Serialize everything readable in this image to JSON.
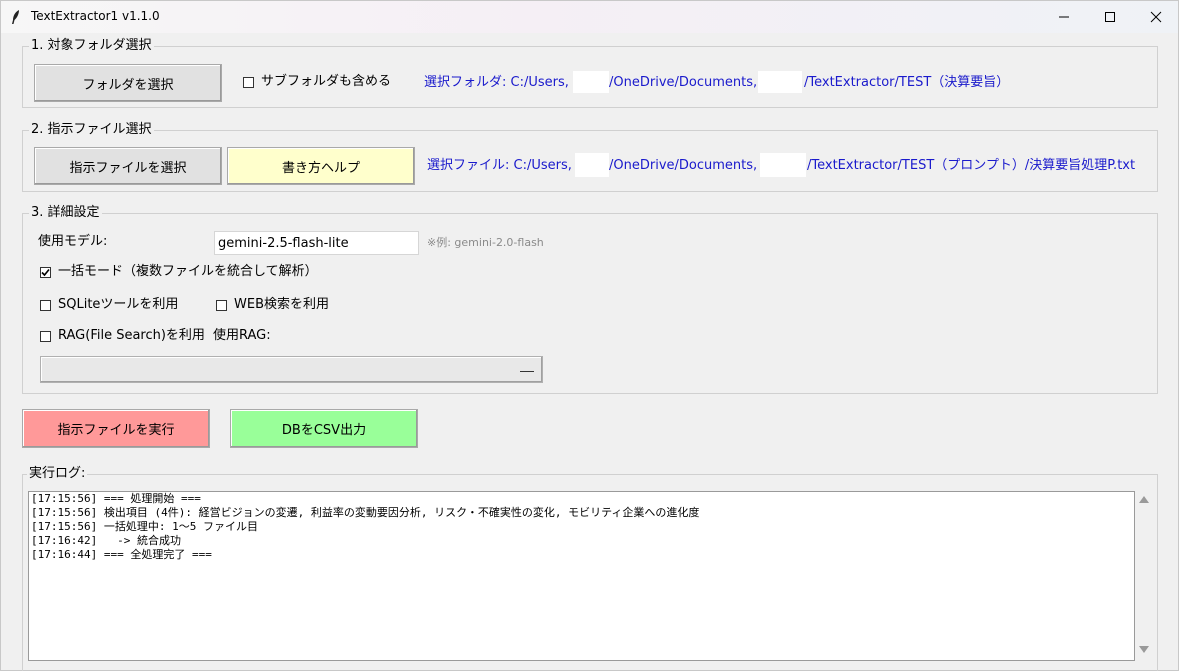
{
  "window": {
    "title": "TextExtractor1 v1.1.0"
  },
  "folder_section": {
    "group_label": "1. 対象フォルダ選択",
    "select_button": "フォルダを選択",
    "include_subfolders_label": "サブフォルダも含める",
    "include_subfolders_checked": false,
    "selected_path_prefix": "選択フォルダ: C:/Users,",
    "selected_path_mid": "/OneDrive/Documents,",
    "selected_path_suffix": "/TextExtractor/TEST（決算要旨）"
  },
  "instruction_section": {
    "group_label": "2. 指示ファイル選択",
    "select_button": "指示ファイルを選択",
    "help_button": "書き方ヘルプ",
    "selected_file_prefix": "選択ファイル: C:/Users,",
    "selected_file_mid": "/OneDrive/Documents,",
    "selected_file_suffix": "/TextExtractor/TEST（プロンプト）/決算要旨処理P.txt"
  },
  "settings_section": {
    "group_label": "3. 詳細設定",
    "model_label": "使用モデル:",
    "model_value": "gemini-2.5-flash-lite",
    "model_hint": "※例: gemini-2.0-flash",
    "batch_mode_label": "一括モード（複数ファイルを統合して解析）",
    "batch_mode_checked": true,
    "sqlite_label": "SQLiteツールを利用",
    "sqlite_checked": false,
    "web_search_label": "WEB検索を利用",
    "web_search_checked": false,
    "rag_label": "RAG(File Search)を利用",
    "rag_checked": false,
    "use_rag_label": "使用RAG:",
    "rag_selected": ""
  },
  "actions": {
    "run_button": "指示ファイルを実行",
    "csv_button": "DBをCSV出力"
  },
  "log_section": {
    "group_label": "実行ログ:",
    "lines": [
      "[17:15:56] === 処理開始 ===",
      "[17:15:56] 検出項目 (4件): 経営ビジョンの変遷, 利益率の変動要因分析, リスク・不確実性の変化, モビリティ企業への進化度",
      "[17:15:56] 一括処理中: 1〜5 ファイル目",
      "[17:16:42]   -> 統合成功",
      "[17:16:44] === 全処理完了 ==="
    ]
  },
  "colors": {
    "run_button_bg": "#ff9999",
    "csv_button_bg": "#99ff99",
    "help_button_bg": "#ffffcc",
    "path_text": "#1a1acc"
  }
}
